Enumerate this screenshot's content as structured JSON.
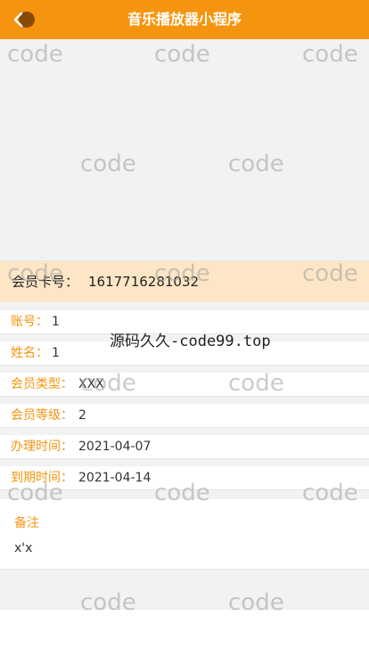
{
  "header": {
    "title": "音乐播放器小程序",
    "back_icon": "back-arrow-icon",
    "accent": "#f5950f"
  },
  "member_card": {
    "label": "会员卡号：",
    "number": "1617716281032"
  },
  "fields": [
    {
      "label": "账号：",
      "value": "1"
    },
    {
      "label": "姓名：",
      "value": "1"
    },
    {
      "label": "会员类型：",
      "value": "XXX"
    },
    {
      "label": "会员等级：",
      "value": "2"
    },
    {
      "label": "办理时间：",
      "value": "2021-04-07"
    },
    {
      "label": "到期时间：",
      "value": "2021-04-14"
    }
  ],
  "remark": {
    "label": "备注",
    "value": "x'x"
  },
  "watermark": {
    "text": "code",
    "center_text": "源码久久-code99.top"
  }
}
